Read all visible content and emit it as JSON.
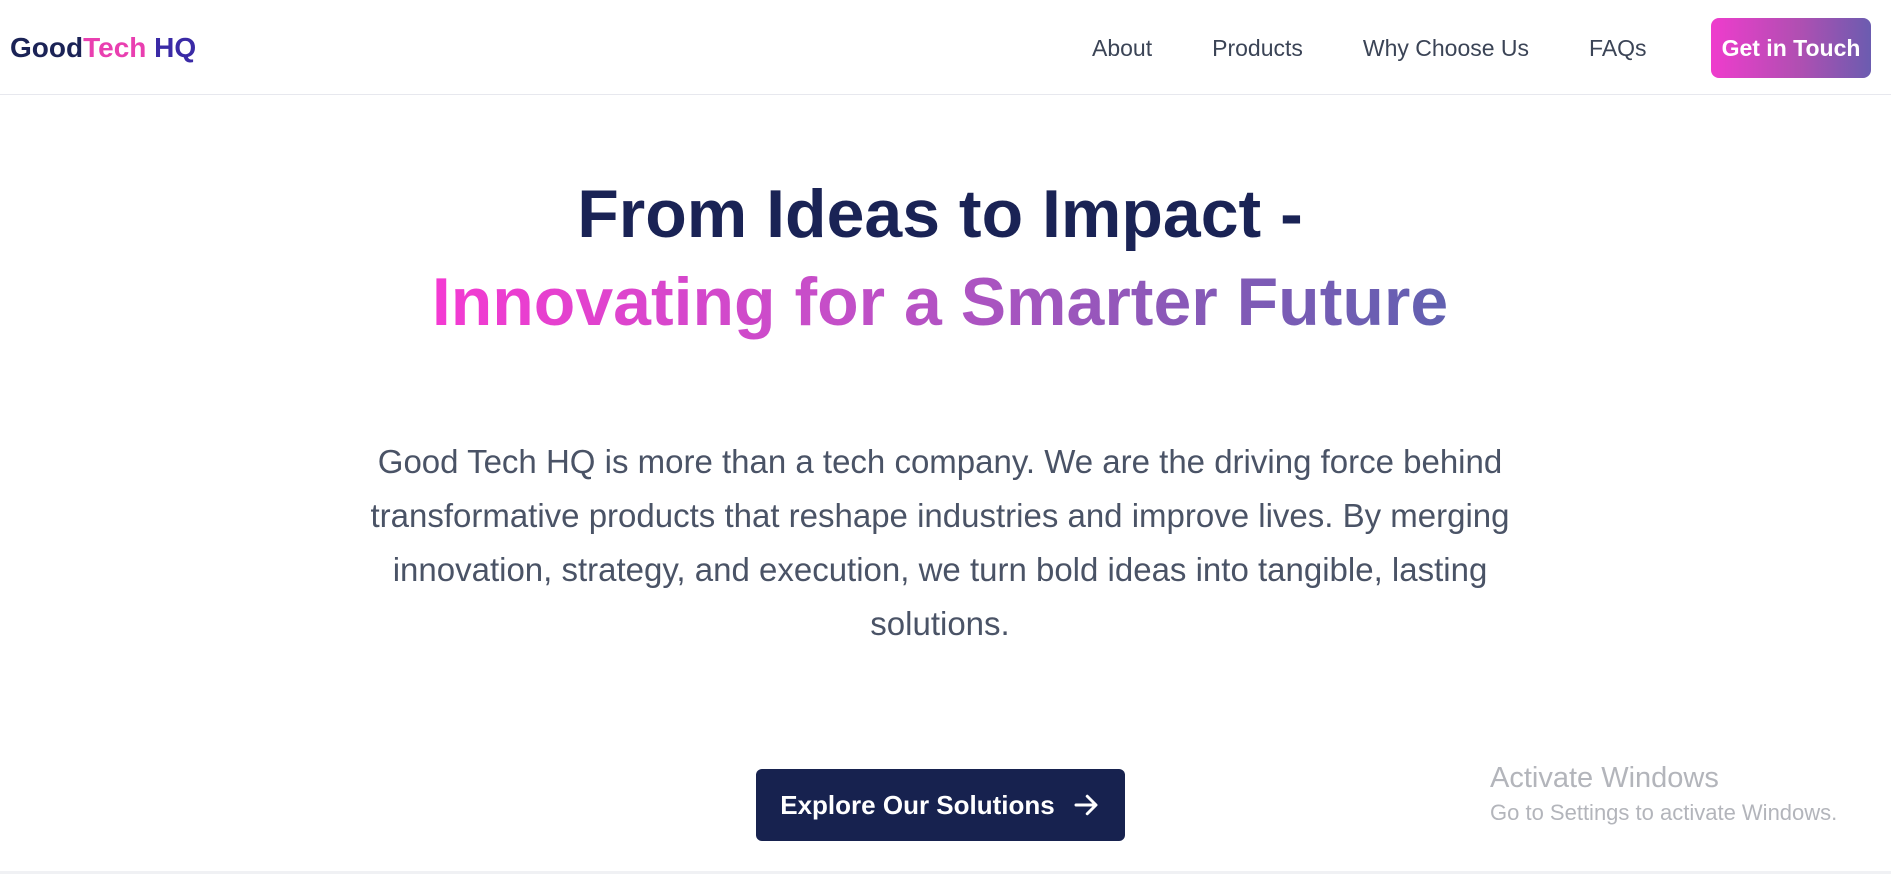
{
  "header": {
    "logo": {
      "part1": "Good",
      "part2": "Tech",
      "part3": "HQ"
    },
    "nav": [
      {
        "label": "About"
      },
      {
        "label": "Products"
      },
      {
        "label": "Why Choose Us"
      },
      {
        "label": "FAQs"
      }
    ],
    "cta_label": "Get in Touch"
  },
  "hero": {
    "title_line1": "From Ideas to Impact -",
    "title_line2": "Innovating for a Smarter Future",
    "description": "Good Tech HQ is more than a tech company. We are the driving force behind transformative products that reshape industries and improve lives. By merging innovation, strategy, and execution, we turn bold ideas into tangible, lasting solutions.",
    "button_label": "Explore Our Solutions",
    "button_icon": "arrow-right-icon"
  },
  "watermark": {
    "title": "Activate Windows",
    "subtitle": "Go to Settings to activate Windows."
  },
  "colors": {
    "navy": "#1a2355",
    "pink": "#ef3ccd",
    "purple": "#6b5cb0",
    "text_gray": "#4a5366"
  }
}
